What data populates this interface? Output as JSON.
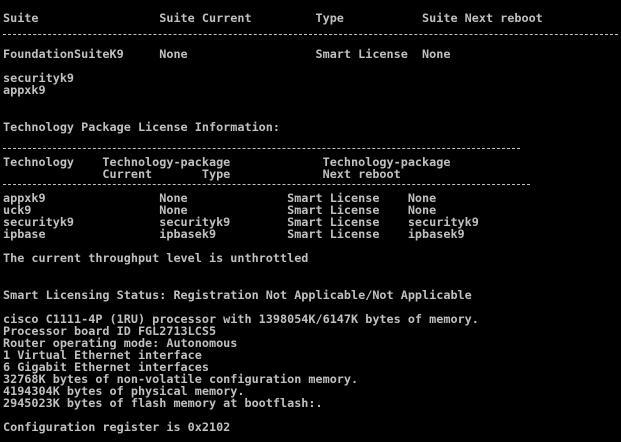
{
  "terminal": {
    "lines": [
      "Suite                 Suite Current         Type           Suite Next reboot",
      "FoundationSuiteK9     None                  Smart License  None",
      "securityk9",
      "appxk9",
      "Technology Package License Information:",
      "Technology    Technology-package             Technology-package",
      "              Current       Type             Next reboot",
      "appxk9                None              Smart License    None",
      "uck9                  None              Smart License    None",
      "securityk9            securityk9        Smart License    securityk9",
      "ipbase                ipbasek9          Smart License    ipbasek9",
      "The current throughput level is unthrottled",
      "Smart Licensing Status: Registration Not Applicable/Not Applicable",
      "cisco C1111-4P (1RU) processor with 1398054K/6147K bytes of memory.",
      "Processor board ID FGL2713LCS5",
      "Router operating mode: Autonomous",
      "1 Virtual Ethernet interface",
      "6 Gigabit Ethernet interfaces",
      "32768K bytes of non-volatile configuration memory.",
      "4194304K bytes of physical memory.",
      "2945023K bytes of flash memory at bootflash:.",
      "Configuration register is 0x2102"
    ],
    "colors": {
      "background": "#000000",
      "text": "#c0c0c0"
    }
  }
}
